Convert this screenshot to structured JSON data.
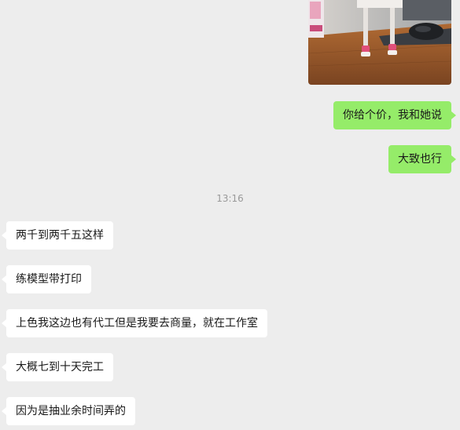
{
  "chat": {
    "photo": {
      "icon": "photo-thumbnail",
      "description_colors": {
        "desk": "#9a5a2c",
        "wall": "#c9c4be",
        "mat": "#3a3d42"
      }
    },
    "messages_out": [
      {
        "text": "你给个价，我和她说"
      },
      {
        "text": "大致也行"
      }
    ],
    "timestamp": "13:16",
    "messages_in": [
      {
        "text": "两千到两千五这样"
      },
      {
        "text": "练模型带打印"
      },
      {
        "text": "上色我这边也有代工但是我要去商量，就在工作室"
      },
      {
        "text": "大概七到十天完工"
      },
      {
        "text": "因为是抽业余时间弄的"
      }
    ],
    "colors": {
      "background": "#ededed",
      "outgoing_bubble": "#95ec69",
      "incoming_bubble": "#ffffff",
      "timestamp": "#9a9a9a"
    }
  }
}
